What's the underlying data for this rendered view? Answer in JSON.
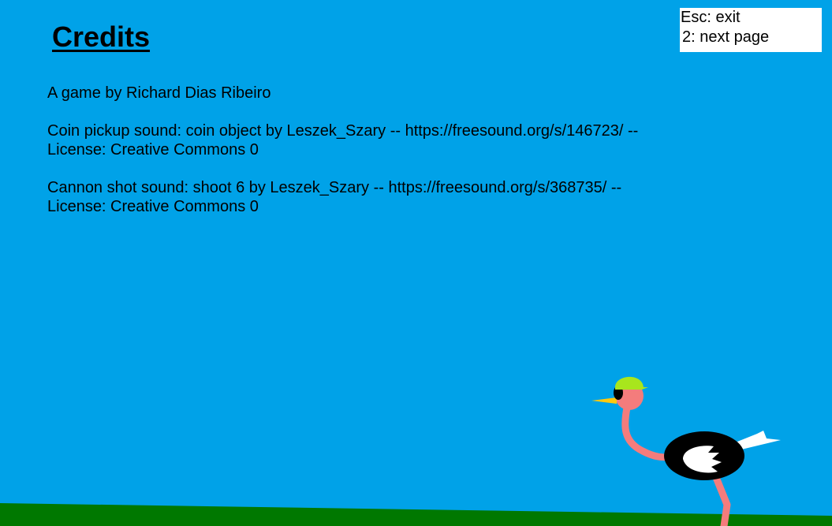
{
  "screen": {
    "title": "Credits",
    "background_color": "#00a2e8",
    "ground_color": "#007800"
  },
  "credits": {
    "author_line": "A game by Richard Dias Ribeiro",
    "coin_sound_line1": "Coin pickup sound: coin object by Leszek_Szary -- https://freesound.org/s/146723/ --",
    "coin_sound_line2": "License: Creative Commons 0",
    "cannon_sound_line1": "Cannon shot sound: shoot 6 by Leszek_Szary -- https://freesound.org/s/368735/ --",
    "cannon_sound_line2": "License: Creative Commons 0"
  },
  "controls": {
    "exit_hint": "Esc: exit",
    "next_hint": "2: next page"
  },
  "character": {
    "icon": "ostrich-icon",
    "body_color": "#000000",
    "neck_color": "#f47c7c",
    "cap_color": "#a8e61d",
    "beak_color": "#ffc90e"
  }
}
